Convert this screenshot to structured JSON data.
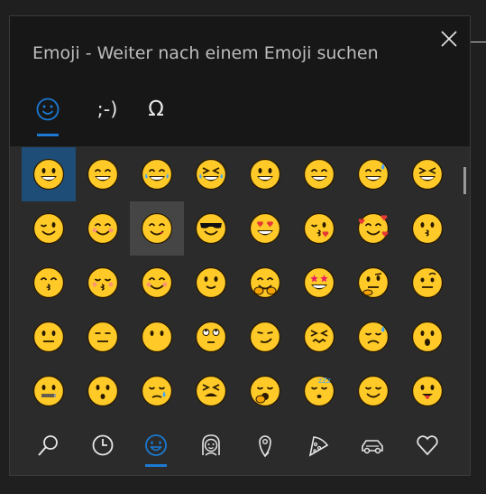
{
  "window": {
    "title": "Emoji - Weiter nach einem Emoji suchen"
  },
  "tabs": [
    {
      "id": "emoji",
      "glyph": "☺",
      "selected": true
    },
    {
      "id": "kaomoji",
      "glyph": ";-)",
      "selected": false
    },
    {
      "id": "symbols",
      "glyph": "Ω",
      "selected": false
    }
  ],
  "emoji_grid": {
    "selected_index": 0,
    "hovered_index": 10,
    "rows": [
      [
        "grinning-face",
        "beaming-face",
        "face-with-tears-of-joy",
        "rolling-on-floor-laughing",
        "grinning-face-big-eyes",
        "grinning-face-smiling-eyes",
        "grinning-face-with-sweat",
        "squinting-face"
      ],
      [
        "winking-face",
        "smiling-face-smiling-eyes",
        "face-savoring-food",
        "smiling-face-with-sunglasses",
        "smiling-face-heart-eyes",
        "face-blowing-kiss",
        "smiling-face-with-hearts",
        "kissing-face"
      ],
      [
        "kissing-face-smiling-eyes",
        "kissing-face-closed-eyes",
        "smiling-face",
        "slightly-smiling-face",
        "hugging-face",
        "star-struck",
        "thinking-face",
        "face-with-raised-eyebrow"
      ],
      [
        "neutral-face",
        "expressionless-face",
        "face-without-mouth",
        "face-with-rolling-eyes",
        "smirking-face",
        "persevering-face",
        "sad-but-relieved-face",
        "face-with-open-mouth"
      ],
      [
        "zipper-mouth-face",
        "hushed-face",
        "sleepy-face",
        "tired-face",
        "yawning-face",
        "sleeping-face",
        "relieved-face",
        "face-with-tongue"
      ]
    ]
  },
  "categories": [
    {
      "icon": "search-icon",
      "selected": false
    },
    {
      "icon": "clock-icon",
      "selected": false
    },
    {
      "icon": "smiley-icon",
      "selected": true
    },
    {
      "icon": "person-icon",
      "selected": false
    },
    {
      "icon": "location-pin-icon",
      "selected": false
    },
    {
      "icon": "pizza-icon",
      "selected": false
    },
    {
      "icon": "car-icon",
      "selected": false
    },
    {
      "icon": "heart-icon",
      "selected": false
    }
  ],
  "colors": {
    "accent": "#1a7ad4",
    "emoji_face": "#ffca28",
    "emoji_outline": "#2a1b00",
    "header_bg": "#171717",
    "body_bg": "#2b2b2b"
  }
}
